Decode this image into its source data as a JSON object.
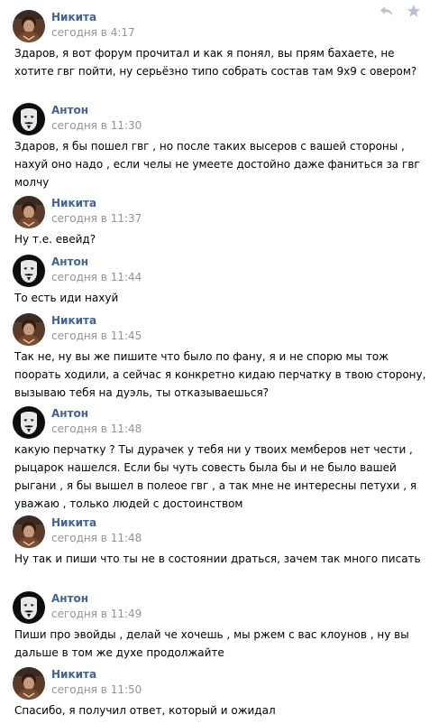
{
  "header_actions": {
    "reply_icon": "reply-arrow-icon",
    "star_icon": "star-icon",
    "color": "#b9c3cf"
  },
  "colors": {
    "author": "#42648b",
    "time": "#939393",
    "text": "#000000",
    "avatar_nikita": "#7a4a32",
    "avatar_anton": "#0d0d0d"
  },
  "messages": [
    {
      "author": "Никита",
      "time": "сегодня в 4:17",
      "avatar": "nikita-avatar",
      "text": "Здаров, я вот форум прочитал и как я понял, вы прям бахаете, не хотите гвг пойти, ну серьёзно типо собрать состав там 9х9 с овером?"
    },
    {
      "author": "Антон",
      "time": "сегодня в 11:30",
      "avatar": "anton-avatar",
      "text": "Здаров, я бы пошел гвг , но после таких высеров с вашей стороны , нахуй оно надо , если челы не умеете достойно даже фаниться за гвг молчу"
    },
    {
      "author": "Никита",
      "time": "сегодня в 11:37",
      "avatar": "nikita-avatar",
      "text": "Ну т.е. евейд?"
    },
    {
      "author": "Антон",
      "time": "сегодня в 11:44",
      "avatar": "anton-avatar",
      "text": "То есть иди нахуй"
    },
    {
      "author": "Никита",
      "time": "сегодня в 11:45",
      "avatar": "nikita-avatar",
      "text": "Так не, ну вы же пишите что было по фану, я и не спорю мы тож поорать ходили, а сейчас я конкретно кидаю перчатку в твою сторону, вызываю тебя на дуэль, ты отказываешься?"
    },
    {
      "author": "Антон",
      "time": "сегодня в 11:48",
      "avatar": "anton-avatar",
      "text": "какую перчатку ? Ты дурачек у тебя ни у твоих мемберов нет чести , рыцарок нашелся. Если бы чуть совесть была бы и не было вашей рыгани , я бы вышел в полеое гвг , а так мне не интересны петухи , я уважаю , только людей с достоинством"
    },
    {
      "author": "Никита",
      "time": "сегодня в 11:48",
      "avatar": "nikita-avatar",
      "text": "Ну так и пиши что ты не в состоянии драться, зачем так много писать"
    },
    {
      "author": "Антон",
      "time": "сегодня в 11:49",
      "avatar": "anton-avatar",
      "text": "Пиши про эвойды , делай че хочешь , мы ржем с вас клоунов , ну вы дальше в том же духе продолжайте"
    },
    {
      "author": "Никита",
      "time": "сегодня в 11:50",
      "avatar": "nikita-avatar",
      "text": "Спасибо, я получил ответ, который и ожидал"
    }
  ]
}
